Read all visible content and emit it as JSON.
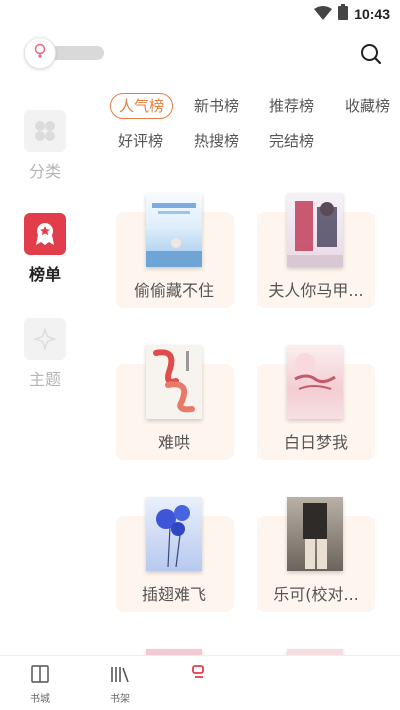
{
  "status_bar": {
    "time": "10:43"
  },
  "sidebar": {
    "items": [
      {
        "label": "分类",
        "active": false
      },
      {
        "label": "榜单",
        "active": true
      },
      {
        "label": "主题",
        "active": false
      }
    ]
  },
  "rank_tabs": {
    "row1": [
      "人气榜",
      "新书榜",
      "推荐榜",
      "收藏榜"
    ],
    "row2": [
      "好评榜",
      "热搜榜",
      "完结榜"
    ],
    "active": "人气榜"
  },
  "books": [
    {
      "title": "偷偷藏不住"
    },
    {
      "title": "夫人你马甲..."
    },
    {
      "title": "难哄"
    },
    {
      "title": "白日梦我"
    },
    {
      "title": "插翅难飞"
    },
    {
      "title": "乐可(校对..."
    }
  ],
  "bottom_nav": {
    "items": [
      {
        "label": "书城",
        "icon": "book-open-icon"
      },
      {
        "label": "书架",
        "icon": "bookshelf-icon"
      },
      {
        "label": "",
        "icon": "rank-icon"
      }
    ]
  },
  "colors": {
    "accent": "#e57d41",
    "active_sidebar": "#e23d4b",
    "card_bg": "#fff5ef",
    "inactive_text": "#b5b5b5"
  }
}
